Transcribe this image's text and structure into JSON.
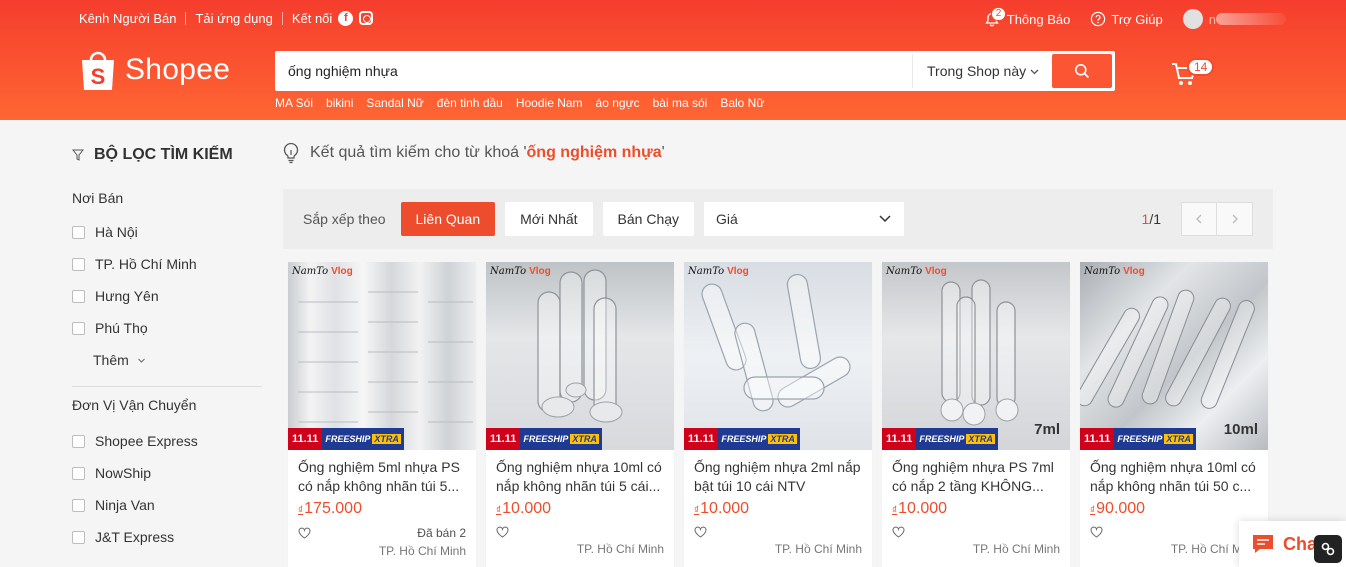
{
  "topbar": {
    "seller_channel": "Kênh Người Bán",
    "download_app": "Tải ứng dụng",
    "connect": "Kết nối",
    "social_icons": [
      "facebook-icon",
      "instagram-icon"
    ],
    "notifications_label": "Thông Báo",
    "notifications_count": "2",
    "help_label": "Trợ Giúp",
    "user_name": "n"
  },
  "header": {
    "brand": "Shopee",
    "search_query": "ống nghiệm nhựa",
    "search_scope": "Trong Shop này",
    "suggestions": [
      "MA Sói",
      "bikini",
      "Sandal Nữ",
      "đèn tinh dầu",
      "Hoodie Nam",
      "áo ngực",
      "bài ma sói",
      "Balo Nữ"
    ],
    "cart_count": "14",
    "accent": "#ee4d2d"
  },
  "sidebar": {
    "title": "BỘ LỌC TÌM KIẾM",
    "location_title": "Nơi Bán",
    "locations": [
      "Hà Nội",
      "TP. Hồ Chí Minh",
      "Hưng Yên",
      "Phú Thọ"
    ],
    "more_label": "Thêm",
    "shipping_title": "Đơn Vị Vận Chuyển",
    "shipping": [
      "Shopee Express",
      "NowShip",
      "Ninja Van",
      "J&T Express"
    ]
  },
  "results": {
    "hint_prefix": "Kết quả tìm kiếm cho từ khoá '",
    "keyword": "ống nghiệm nhựa",
    "hint_suffix": "'"
  },
  "sortbar": {
    "label": "Sắp xếp theo",
    "relevant": "Liên Quan",
    "latest": "Mới Nhất",
    "top_sales": "Bán Chạy",
    "price": "Giá",
    "page_current": "1",
    "page_total": "/1"
  },
  "products": [
    {
      "name": "Ống nghiệm 5ml nhựa PS có nắp không nhãn túi 5...",
      "currency": "₫",
      "price": "175.000",
      "sold": "Đã bán 2",
      "location": "TP. Hồ Chí Minh",
      "watermark": "NamTo",
      "watermark_tag": "Vlog",
      "promo_1": "11.11",
      "promo_2": "FREESHIP",
      "promo_3": "XTRA",
      "volume": ""
    },
    {
      "name": "Ống nghiệm nhựa 10ml có nắp không nhãn túi 5 cái...",
      "currency": "₫",
      "price": "10.000",
      "sold": "",
      "location": "TP. Hồ Chí Minh",
      "watermark": "NamTo",
      "watermark_tag": "Vlog",
      "promo_1": "11.11",
      "promo_2": "FREESHIP",
      "promo_3": "XTRA",
      "volume": ""
    },
    {
      "name": "Ống nghiệm nhựa 2ml nắp bật túi 10 cái NTV",
      "currency": "₫",
      "price": "10.000",
      "sold": "",
      "location": "TP. Hồ Chí Minh",
      "watermark": "NamTo",
      "watermark_tag": "Vlog",
      "promo_1": "11.11",
      "promo_2": "FREESHIP",
      "promo_3": "XTRA",
      "volume": ""
    },
    {
      "name": "Ống nghiệm nhựa PS 7ml có nắp 2 tầng KHÔNG...",
      "currency": "₫",
      "price": "10.000",
      "sold": "",
      "location": "TP. Hồ Chí Minh",
      "watermark": "NamTo",
      "watermark_tag": "Vlog",
      "promo_1": "11.11",
      "promo_2": "FREESHIP",
      "promo_3": "XTRA",
      "volume": "7ml"
    },
    {
      "name": "Ống nghiệm nhựa 10ml có nắp không nhãn túi 50 c...",
      "currency": "₫",
      "price": "90.000",
      "sold": "",
      "location": "TP. Hồ Chí Minh",
      "watermark": "NamTo",
      "watermark_tag": "Vlog",
      "promo_1": "11.11",
      "promo_2": "FREESHIP",
      "promo_3": "XTRA",
      "volume": "10ml"
    }
  ],
  "chat": {
    "label": "Chat"
  }
}
